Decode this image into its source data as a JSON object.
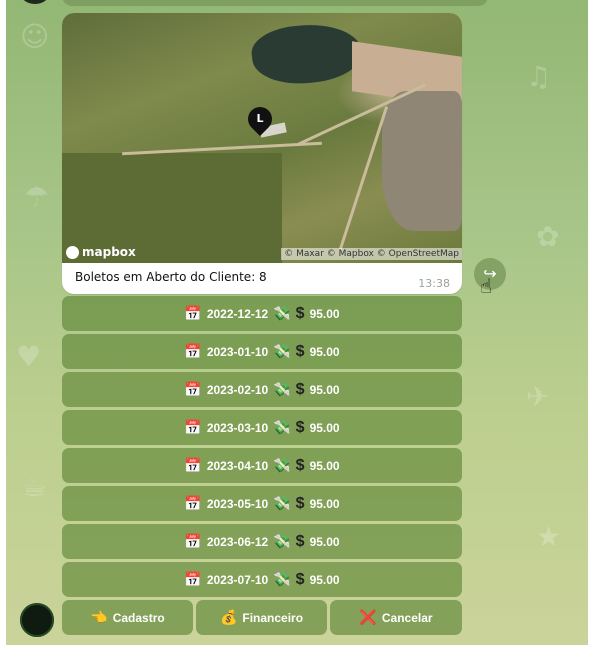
{
  "message": {
    "caption": "Boletos em Aberto do Cliente: 8",
    "time": "13:38",
    "map": {
      "provider": "mapbox",
      "attribution": "© Maxar © Mapbox © OpenStreetMap",
      "pin_label": "L"
    }
  },
  "boletos": [
    {
      "date": "2022-12-12",
      "value": "95.00"
    },
    {
      "date": "2023-01-10",
      "value": "95.00"
    },
    {
      "date": "2023-02-10",
      "value": "95.00"
    },
    {
      "date": "2023-03-10",
      "value": "95.00"
    },
    {
      "date": "2023-04-10",
      "value": "95.00"
    },
    {
      "date": "2023-05-10",
      "value": "95.00"
    },
    {
      "date": "2023-06-12",
      "value": "95.00"
    },
    {
      "date": "2023-07-10",
      "value": "95.00"
    }
  ],
  "icons": {
    "calendar": "📅",
    "money": "💸",
    "dollar": "$",
    "cadastro": "👈",
    "financeiro": "💰",
    "cancelar": "❌",
    "share": "↪"
  },
  "actions": {
    "cadastro": "Cadastro",
    "financeiro": "Financeiro",
    "cancelar": "Cancelar"
  },
  "colors": {
    "button_bg": "#5a8232",
    "cancel_icon": "#e0201d"
  }
}
